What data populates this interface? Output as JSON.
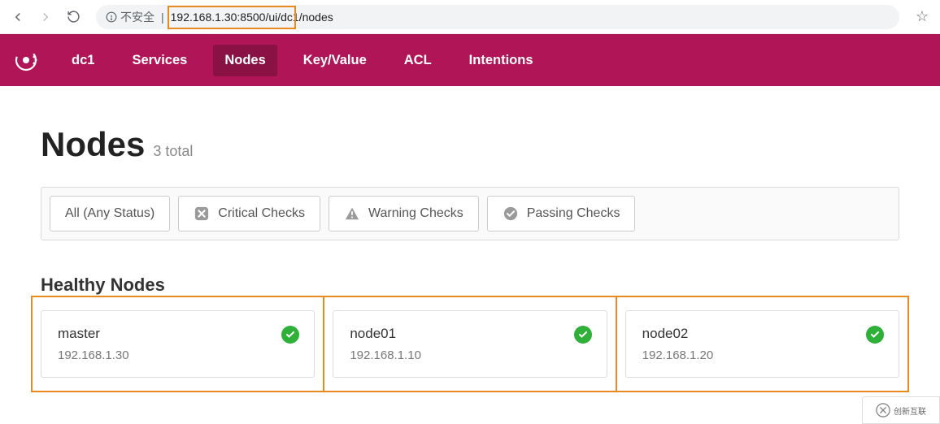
{
  "browser": {
    "security_label": "不安全",
    "url_host": "192.168.1.30",
    "url_port": ":8500",
    "url_path_a": "/ui/dc",
    "url_path_b": "1/nodes"
  },
  "nav": {
    "dc": "dc1",
    "items": [
      "Services",
      "Nodes",
      "Key/Value",
      "ACL",
      "Intentions"
    ],
    "active": "Nodes"
  },
  "page": {
    "title": "Nodes",
    "count": "3 total",
    "section": "Healthy Nodes"
  },
  "filters": {
    "all": "All (Any Status)",
    "critical": "Critical Checks",
    "warning": "Warning Checks",
    "passing": "Passing Checks"
  },
  "nodes": [
    {
      "name": "master",
      "ip": "192.168.1.30"
    },
    {
      "name": "node01",
      "ip": "192.168.1.10"
    },
    {
      "name": "node02",
      "ip": "192.168.1.20"
    }
  ],
  "badge": "创新互联"
}
